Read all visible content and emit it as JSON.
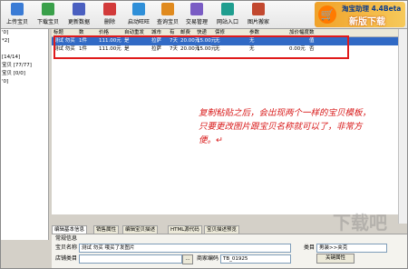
{
  "toolbar": {
    "buttons": [
      {
        "label": "上传宝贝",
        "icon": "upload-icon",
        "color": "#3a7bd5"
      },
      {
        "label": "下载宝贝",
        "icon": "download-icon",
        "color": "#3aa04a"
      },
      {
        "label": "更新数据",
        "icon": "refresh-icon",
        "color": "#4a5fc0"
      },
      {
        "label": "删除",
        "icon": "delete-icon",
        "color": "#d23a3a"
      },
      {
        "label": "启动旺旺",
        "icon": "wangwang-icon",
        "color": "#2f8fd8"
      },
      {
        "label": "查询宝贝",
        "icon": "search-icon",
        "color": "#e08a1e"
      },
      {
        "label": "交易管理",
        "icon": "trade-icon",
        "color": "#7a5cc4"
      },
      {
        "label": "网站入口",
        "icon": "website-icon",
        "color": "#1f9e8f"
      },
      {
        "label": "图片搬家",
        "icon": "image-move-icon",
        "color": "#c2482f"
      }
    ],
    "brand": {
      "title": "淘宝助理 4.4Beta",
      "subtitle": "新版下载",
      "cart": "🛒"
    }
  },
  "tree": [
    "'0]",
    "*2]",
    "",
    "[14/14]",
    "宝贝 [77/77]",
    "宝贝 [0/0]",
    "'0]"
  ],
  "grid": {
    "headers": [
      "标题",
      "数",
      "价格",
      "自动重发",
      "城市",
      "有",
      "邮费",
      "快递",
      "保修",
      "",
      "参数",
      "加价幅度",
      "数"
    ],
    "rows": [
      {
        "cells": [
          "测试 勿买",
          "1件",
          "111.00元",
          "是",
          "拉萨",
          "7天",
          "20.00元",
          "15.00元",
          "无",
          "",
          "无",
          "",
          "值"
        ],
        "selected": true
      },
      {
        "cells": [
          "测试 勿买",
          "1件",
          "111.00元",
          "是",
          "拉萨",
          "7天",
          "20.00元",
          "15.00元",
          "无",
          "",
          "无",
          "0.00元",
          "否"
        ],
        "selected": false
      }
    ]
  },
  "annotation": "复制粘贴之后，会出现两个一样的宝贝模板，只要更改图片跟宝贝名称就可以了，非常方便。↵",
  "tabs": [
    "编辑基本信息",
    "销售属性",
    "编辑宝贝描述",
    "HTML源代码",
    "宝贝描述预览"
  ],
  "form": {
    "section": "常规信息",
    "name_label": "宝贝名称",
    "name_value": "测试 勿买 哦买了发图片",
    "shop_label": "店铺类目",
    "code_label": "商家编码",
    "code_value": "TB_01925",
    "category_label": "类目",
    "category_value": "男装>>夹克",
    "attr_button": "关键属性",
    "more_button": "..."
  },
  "watermark": "下载吧",
  "colors": {
    "selected": "#316ac5",
    "highlight_box": "#e01b1b",
    "annotation": "#d81818"
  }
}
